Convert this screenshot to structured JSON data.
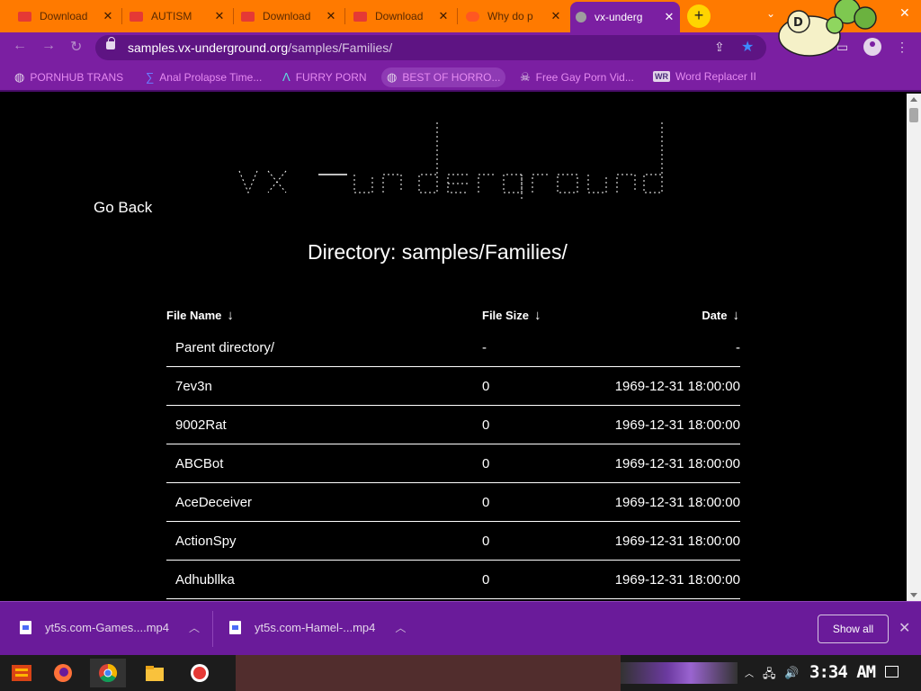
{
  "browser": {
    "tabs": [
      {
        "label": "Download",
        "favicon_color": "#e53935"
      },
      {
        "label": "AUTISM",
        "favicon_color": "#e53935"
      },
      {
        "label": "Download",
        "favicon_color": "#e53935"
      },
      {
        "label": "Download",
        "favicon_color": "#e53935"
      },
      {
        "label": "Why do p",
        "favicon_color": "#ff5722"
      },
      {
        "label": "vx-underg",
        "favicon_color": "#9e9e9e",
        "active": true
      }
    ],
    "new_tab_label": "+",
    "address": {
      "domain": "samples.vx-underground.org",
      "path": "/samples/Families/"
    },
    "bookmarks": [
      {
        "label": "PORNHUB TRANS",
        "icon": "globe-icon"
      },
      {
        "label": "Anal Prolapse Time...",
        "icon": "sigma-icon"
      },
      {
        "label": "FURRY PORN",
        "icon": "lambda-icon"
      },
      {
        "label": "BEST OF HORRO...",
        "icon": "globe-icon"
      },
      {
        "label": "Free Gay Porn Vid...",
        "icon": "skull-icon"
      },
      {
        "label": "Word Replacer II",
        "icon": "wr-icon"
      }
    ]
  },
  "page": {
    "go_back": "Go Back",
    "directory_title": "Directory: samples/Families/",
    "columns": {
      "name": "File Name",
      "size": "File Size",
      "date": "Date",
      "sort_arrow": "↓"
    },
    "rows": [
      {
        "name": "Parent directory/",
        "size": "-",
        "date": "-"
      },
      {
        "name": "7ev3n",
        "size": "0",
        "date": "1969-12-31 18:00:00"
      },
      {
        "name": "9002Rat",
        "size": "0",
        "date": "1969-12-31 18:00:00"
      },
      {
        "name": "ABCBot",
        "size": "0",
        "date": "1969-12-31 18:00:00"
      },
      {
        "name": "AceDeceiver",
        "size": "0",
        "date": "1969-12-31 18:00:00"
      },
      {
        "name": "ActionSpy",
        "size": "0",
        "date": "1969-12-31 18:00:00"
      },
      {
        "name": "Adhubllka",
        "size": "0",
        "date": "1969-12-31 18:00:00"
      }
    ]
  },
  "downloads": {
    "items": [
      {
        "label": "yt5s.com-Games....mp4"
      },
      {
        "label": "yt5s.com-Hamel-...mp4"
      }
    ],
    "show_all": "Show all"
  },
  "taskbar": {
    "clock": "3:34 AM"
  },
  "colors": {
    "tabstrip": "#ff7a00",
    "toolbar": "#7b1fa2",
    "bookmark_text": "#e58bf1",
    "page_bg": "#000000"
  }
}
